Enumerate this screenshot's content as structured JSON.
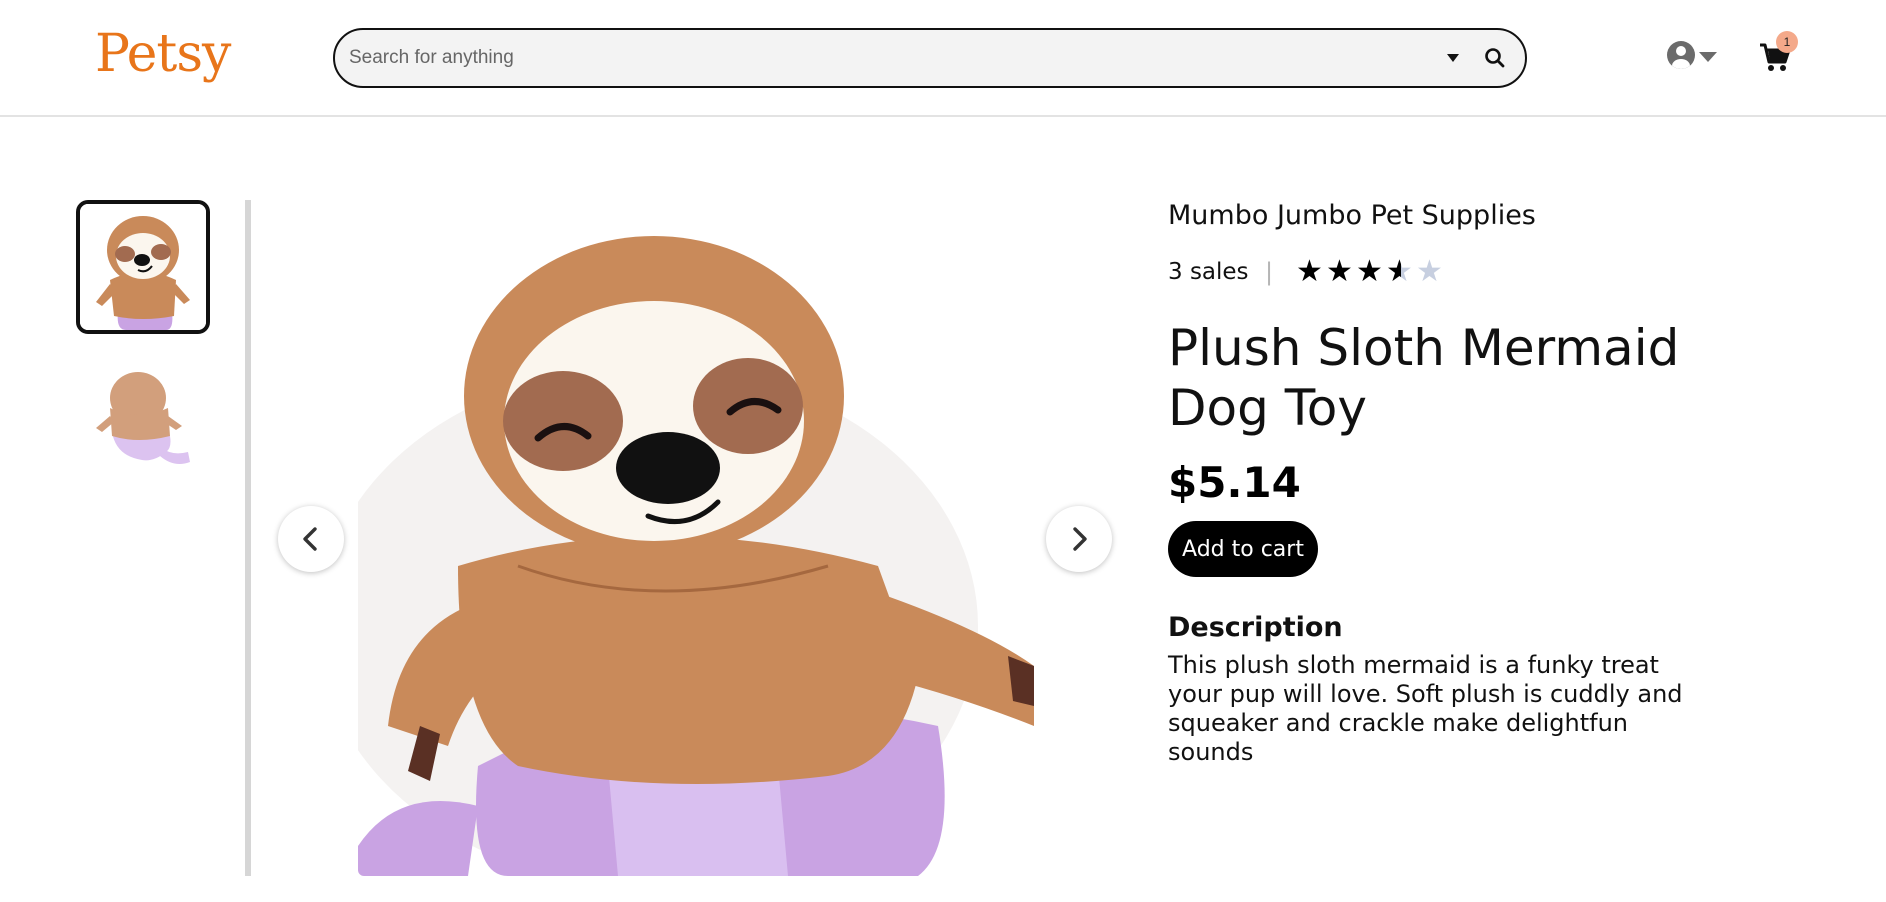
{
  "header": {
    "logo": "Petsy",
    "search_placeholder": "Search for anything",
    "cart_count": "1"
  },
  "gallery": {
    "thumbnails": [
      "sloth-front",
      "sloth-back"
    ],
    "active_index": 0
  },
  "product": {
    "shop_name": "Mumbo Jumbo Pet Supplies",
    "sales": "3 sales",
    "separator": "|",
    "rating": 3.5,
    "rating_max": 5,
    "title": "Plush Sloth Mermaid Dog Toy",
    "price": "$5.14",
    "add_to_cart_label": "Add to cart",
    "description_heading": "Description",
    "description": "This plush sloth mermaid is a funky treat your pup will love. Soft plush is cuddly and squeaker and crackle make delightfun sounds"
  },
  "colors": {
    "brand": "#e8751a",
    "badge": "#f4a98a",
    "star_filled": "#000000",
    "star_empty": "#c7cfe0",
    "plush_brown": "#c98a5a",
    "plush_purple": "#c9a3e3"
  }
}
